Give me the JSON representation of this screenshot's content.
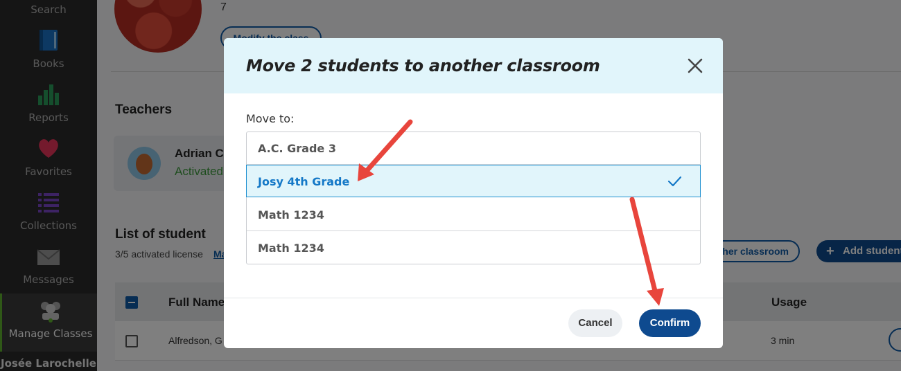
{
  "sidebar": {
    "items": [
      {
        "label": "Search",
        "icon": "search-icon"
      },
      {
        "label": "Books",
        "icon": "book-icon"
      },
      {
        "label": "Reports",
        "icon": "bar-chart-icon"
      },
      {
        "label": "Favorites",
        "icon": "heart-icon"
      },
      {
        "label": "Collections",
        "icon": "list-icon"
      },
      {
        "label": "Messages",
        "icon": "envelope-icon"
      },
      {
        "label": "Manage Classes",
        "icon": "classroom-icon",
        "active": true
      }
    ],
    "user_name": "Josée Larochelle",
    "accent_color": "#5fb12f"
  },
  "class_info": {
    "count": "7",
    "modify_label": "Modify the class"
  },
  "teachers": {
    "heading": "Teachers",
    "items": [
      {
        "name": "Adrian Cl",
        "status": "Activated"
      }
    ]
  },
  "students": {
    "heading": "List of student",
    "license": "3/5 activated license",
    "license_link": "Ma",
    "move_button": "her classroom",
    "add_button": "Add student",
    "columns": [
      "Full Name",
      "Usage"
    ],
    "rows": [
      {
        "name": "Alfredson, G",
        "usage": "3 min"
      }
    ]
  },
  "modal": {
    "title": "Move 2 students to another classroom",
    "move_to_label": "Move to:",
    "classes": [
      {
        "name": "A.C. Grade 3",
        "selected": false
      },
      {
        "name": "Josy 4th Grade",
        "selected": true
      },
      {
        "name": "Math 1234",
        "selected": false
      },
      {
        "name": "Math 1234",
        "selected": false
      }
    ],
    "cancel_label": "Cancel",
    "confirm_label": "Confirm",
    "primary_color": "#0e4a8f",
    "selected_color": "#1478c7",
    "annotation_arrow_color": "#e8453c"
  }
}
